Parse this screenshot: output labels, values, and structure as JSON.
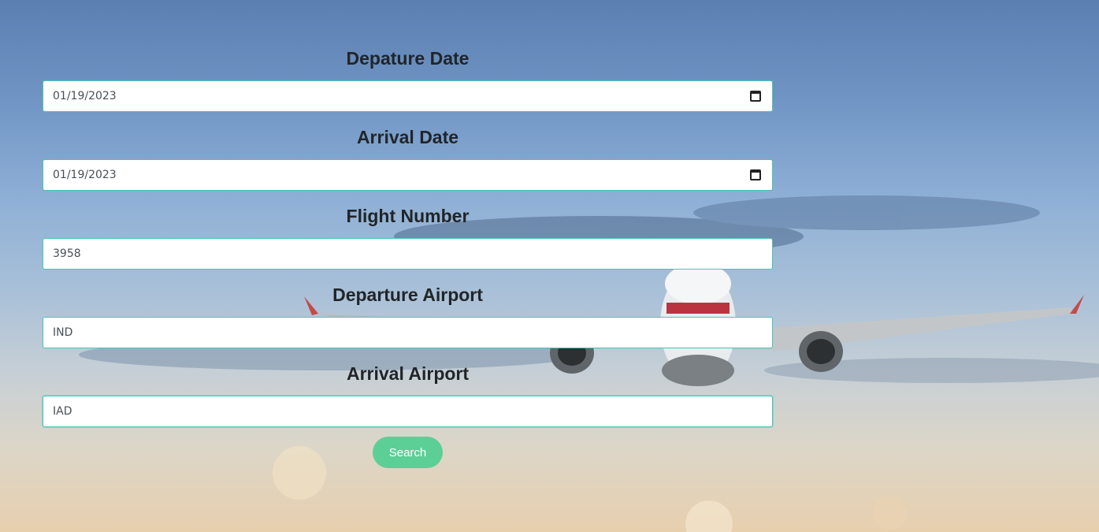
{
  "form": {
    "departure_date": {
      "label": "Depature Date",
      "value": "2023-01-19"
    },
    "arrival_date": {
      "label": "Arrival Date",
      "value": "2023-01-19"
    },
    "flight_number": {
      "label": "Flight Number",
      "value": "3958"
    },
    "departure_airport": {
      "label": "Departure Airport",
      "value": "IND"
    },
    "arrival_airport": {
      "label": "Arrival Airport",
      "value": "IAD"
    },
    "search_label": "Search"
  },
  "colors": {
    "input_border": "#45c7b6",
    "button_bg": "#5ccf97",
    "label_text": "#212529"
  },
  "background": {
    "scene": "airplane-in-sky",
    "icon": "airplane-icon"
  }
}
